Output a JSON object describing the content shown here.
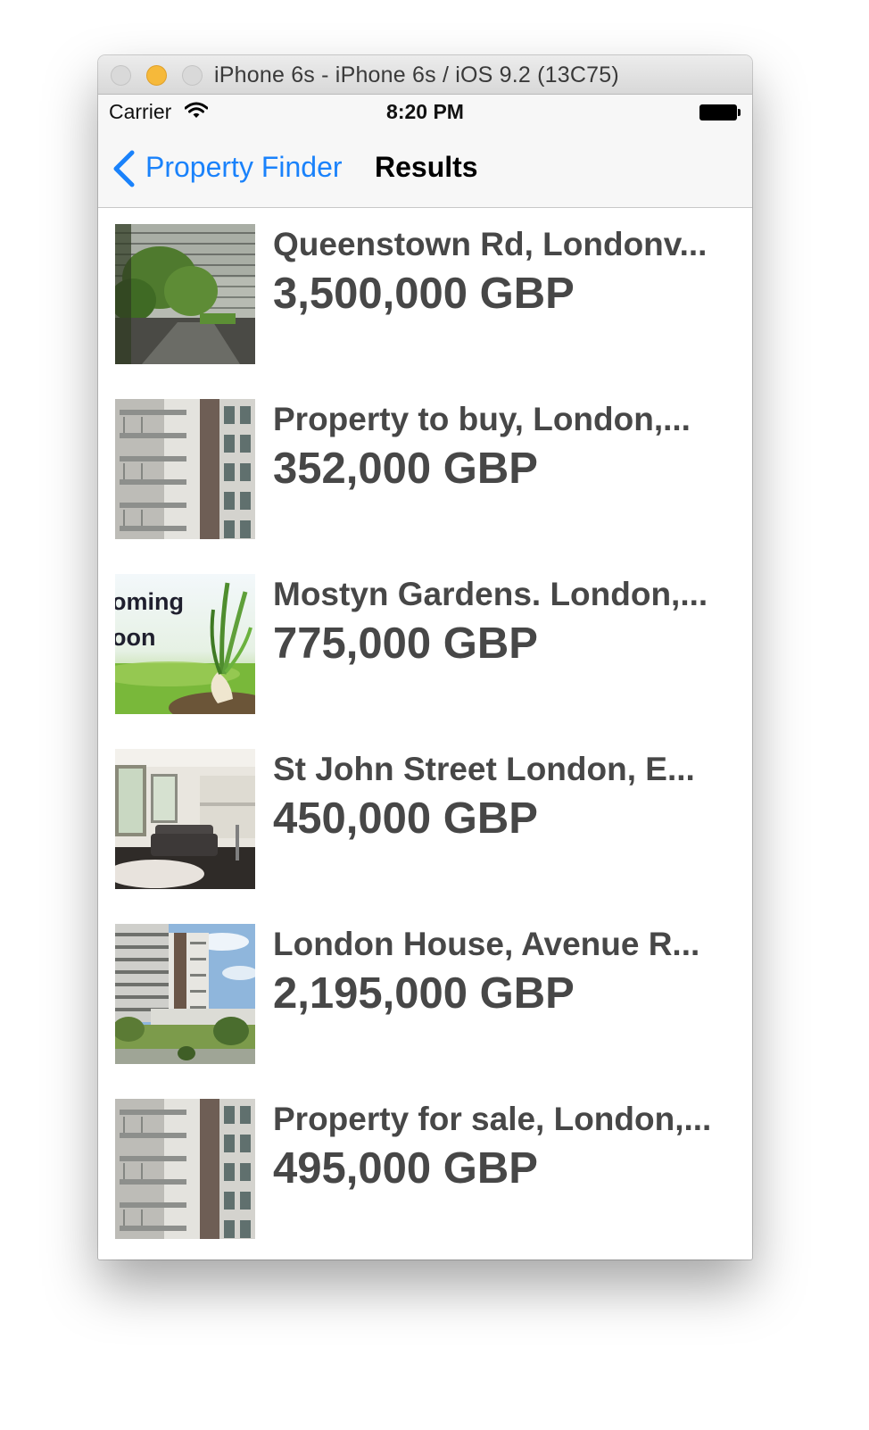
{
  "window": {
    "title": "iPhone 6s - iPhone 6s / iOS 9.2 (13C75)"
  },
  "status_bar": {
    "carrier": "Carrier",
    "time": "8:20 PM"
  },
  "nav_bar": {
    "back_label": "Property Finder",
    "title": "Results",
    "tint_color": "#1a82fb"
  },
  "listings": [
    {
      "title": "Queenstown Rd, Londonv...",
      "price": "3,500,000 GBP",
      "image": "apartment-courtyard-photo"
    },
    {
      "title": "Property to buy, London,...",
      "price": "352,000 GBP",
      "image": "balcony-building-photo"
    },
    {
      "title": "Mostyn Gardens. London,...",
      "price": "775,000 GBP",
      "image": "coming-soon-bulb-image",
      "image_text": [
        "oming",
        "oon"
      ]
    },
    {
      "title": "St John Street London, E...",
      "price": "450,000 GBP",
      "image": "living-room-photo"
    },
    {
      "title": "London House, Avenue R...",
      "price": "2,195,000 GBP",
      "image": "tower-block-garden-photo"
    },
    {
      "title": "Property for sale, London,...",
      "price": "495,000 GBP",
      "image": "balcony-building-photo"
    }
  ]
}
